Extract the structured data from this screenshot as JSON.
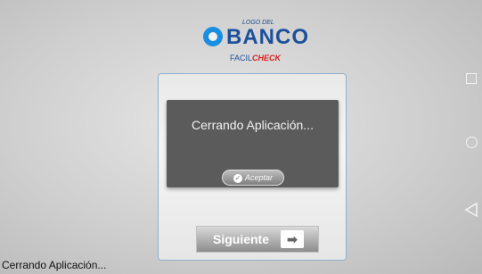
{
  "logo": {
    "small": "LOGO DEL",
    "bank": "BANCO",
    "facil": "FACIL",
    "check": "CHECK",
    "tagline": "FACILCHECK"
  },
  "dialog": {
    "message": "Cerrando Aplicación...",
    "accept_label": "Aceptar"
  },
  "next_button": {
    "label": "Siguiente",
    "arrow": "➡"
  },
  "status_text": "Cerrando Aplicación...",
  "navbar": {
    "icons": [
      "recents-icon",
      "home-icon",
      "back-icon"
    ]
  }
}
